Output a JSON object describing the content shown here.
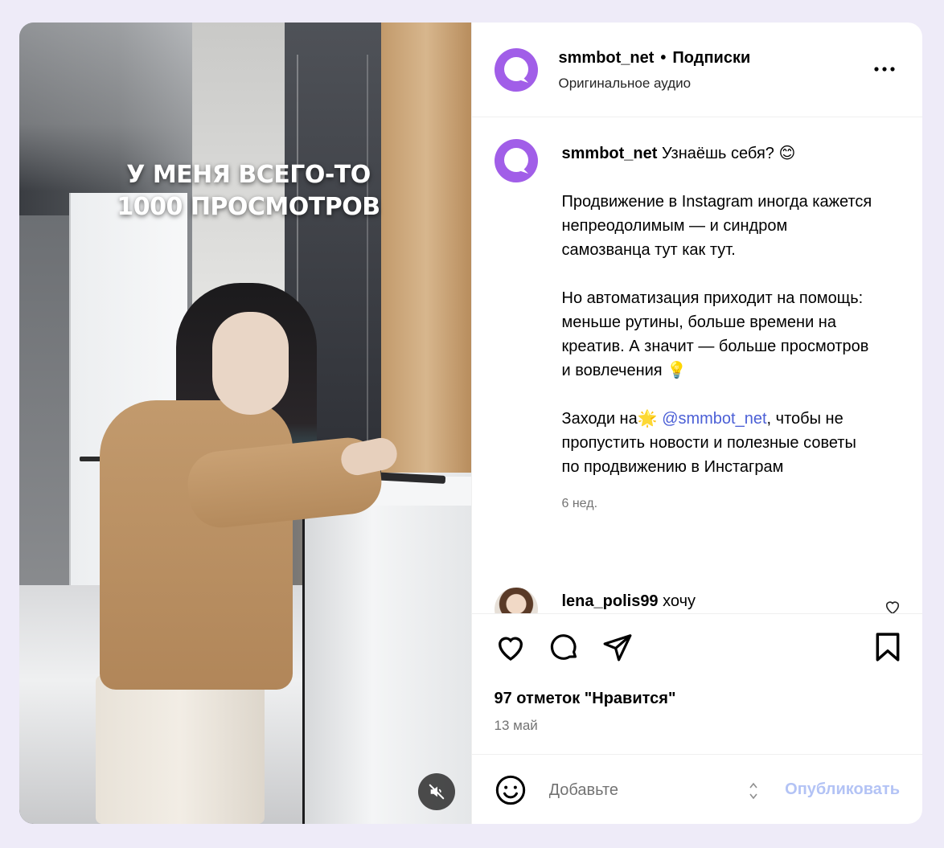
{
  "video": {
    "overlay_line1": "У МЕНЯ ВСЕГО-ТО",
    "overlay_line2": "1000 ПРОСМОТРОВ",
    "mute_icon": "muted-speaker-icon"
  },
  "header": {
    "username": "smmbot_net",
    "separator": "•",
    "follow_label": "Подписки",
    "audio_label": "Оригинальное аудио",
    "more_icon": "more-horizontal-icon"
  },
  "caption": {
    "username": "smmbot_net",
    "line1": "Узнаёшь себя? 😊",
    "para1": "Продвижение в Instagram иногда кажется непреодолимым — и синдром самозванца тут как тут.",
    "para2": "Но автоматизация приходит на помощь: меньше рутины, больше времени на креатив. А значит — больше просмотров и вовлечения 💡",
    "para3_prefix": "Заходи на🌟 ",
    "para3_link": "@smmbot_net",
    "para3_suffix": ", чтобы не пропустить новости и полезные советы по продвижению в Инстаграм",
    "time": "6 нед."
  },
  "comment": {
    "username": "lena_polis99",
    "text": "хочу"
  },
  "actions": {
    "likes": "97 отметок \"Нравится\"",
    "date": "13 май"
  },
  "composer": {
    "placeholder": "Добавьте",
    "publish_label": "Опубликовать"
  },
  "colors": {
    "brand_avatar": "#9b59e6",
    "link": "#4b5fd6",
    "publish_disabled": "#b3c3f5",
    "page_background": "#eeebf8"
  }
}
